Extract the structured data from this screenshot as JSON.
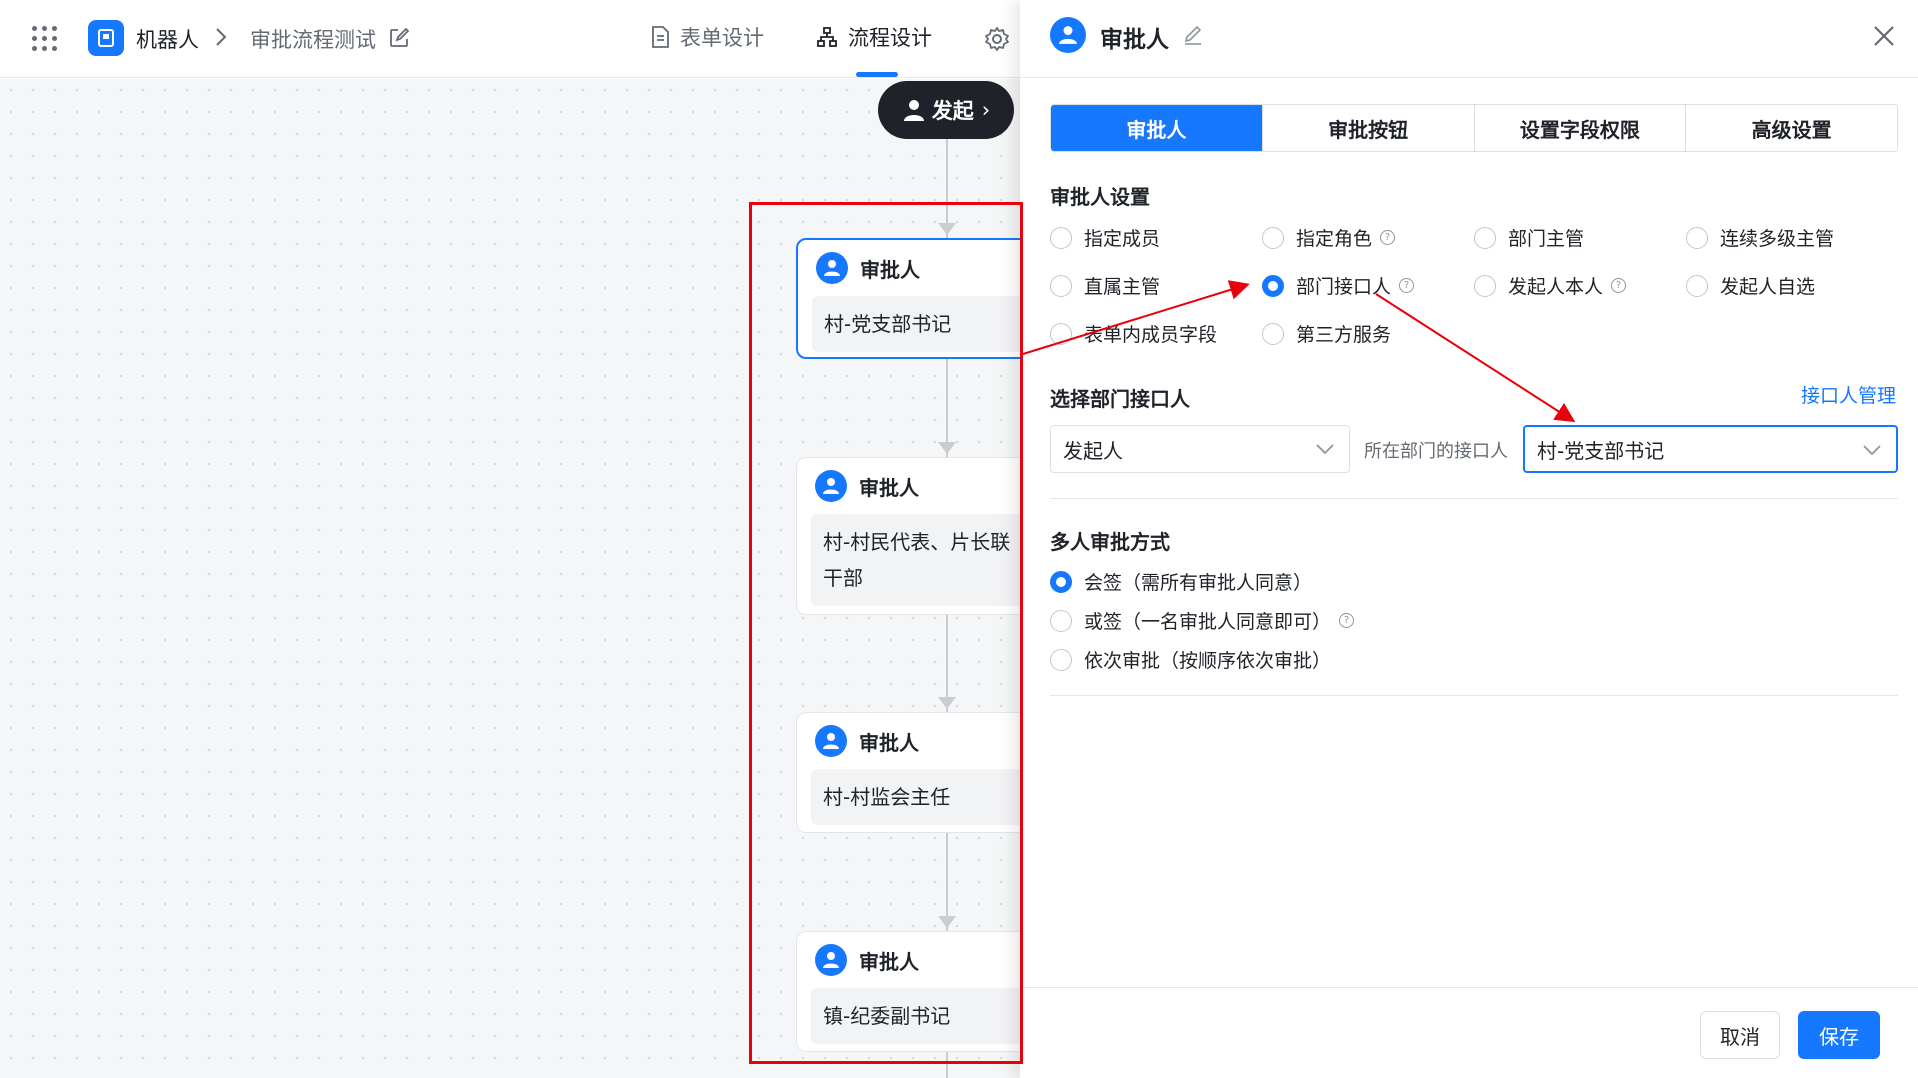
{
  "topbar": {
    "app_name": "机器人",
    "current_flow": "审批流程测试",
    "nav_form_design": "表单设计",
    "nav_flow_design": "流程设计"
  },
  "canvas": {
    "start_label": "发起",
    "nodes": [
      {
        "title": "审批人",
        "body": "村-党支部书记"
      },
      {
        "title": "审批人",
        "body": "村-村民代表、片长联\n干部"
      },
      {
        "title": "审批人",
        "body": "村-村监会主任"
      },
      {
        "title": "审批人",
        "body": "镇-纪委副书记"
      }
    ]
  },
  "panel": {
    "title": "审批人",
    "tabs": [
      "审批人",
      "审批按钮",
      "设置字段权限",
      "高级设置"
    ],
    "approver_settings_title": "审批人设置",
    "approver_options": [
      {
        "label": "指定成员",
        "checked": false,
        "help": false
      },
      {
        "label": "指定角色",
        "checked": false,
        "help": true
      },
      {
        "label": "部门主管",
        "checked": false,
        "help": false
      },
      {
        "label": "连续多级主管",
        "checked": false,
        "help": false
      },
      {
        "label": "直属主管",
        "checked": false,
        "help": false
      },
      {
        "label": "部门接口人",
        "checked": true,
        "help": true
      },
      {
        "label": "发起人本人",
        "checked": false,
        "help": true
      },
      {
        "label": "发起人自选",
        "checked": false,
        "help": false
      },
      {
        "label": "表单内成员字段",
        "checked": false,
        "help": false
      },
      {
        "label": "第三方服务",
        "checked": false,
        "help": false
      }
    ],
    "dept_contact_title": "选择部门接口人",
    "dept_contact_link": "接口人管理",
    "select_scope_value": "发起人",
    "select_middle_text": "所在部门的接口人",
    "select_contact_value": "村-党支部书记",
    "multi_approval_title": "多人审批方式",
    "multi_options": [
      {
        "label": "会签（需所有审批人同意）",
        "checked": true,
        "help": false
      },
      {
        "label": "或签（一名审批人同意即可）",
        "checked": false,
        "help": true
      },
      {
        "label": "依次审批（按顺序依次审批）",
        "checked": false,
        "help": false
      }
    ],
    "cancel_label": "取消",
    "save_label": "保存"
  },
  "colors": {
    "accent": "#1677ff",
    "annotation_red": "#e8000b",
    "dark_node": "#1f2329"
  }
}
